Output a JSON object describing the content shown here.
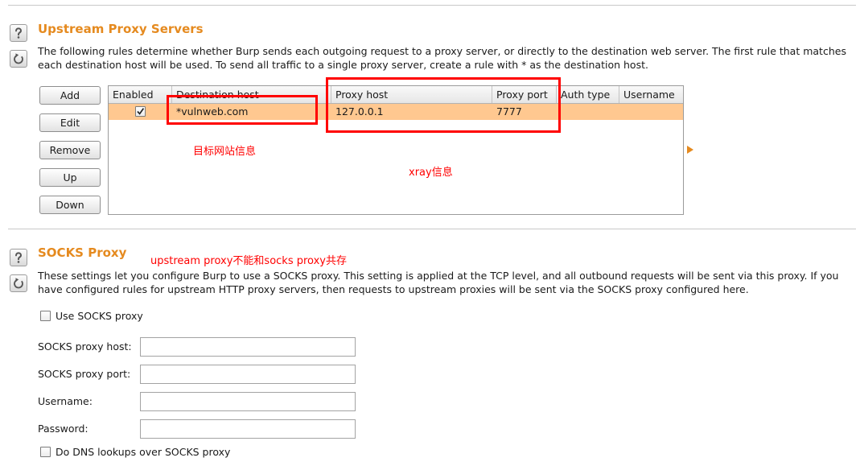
{
  "colors": {
    "heading": "#e58a1f",
    "selected_row": "#ffc890",
    "annotation": "#ff0000"
  },
  "upstream_proxy": {
    "title": "Upstream Proxy Servers",
    "icons": {
      "help": "help-icon",
      "reset": "reset-icon",
      "expand": "right-triangle-icon"
    },
    "description": [
      "The following rules determine whether Burp sends each outgoing request to a proxy server, or directly to the destination web server. The first rule that matches",
      "each destination host will be used. To send all traffic to a single proxy server, create a rule with * as the destination host."
    ],
    "buttons": {
      "add": "Add",
      "edit": "Edit",
      "remove": "Remove",
      "up": "Up",
      "down": "Down"
    },
    "table": {
      "columns": [
        "Enabled",
        "Destination host",
        "Proxy host",
        "Proxy port",
        "Auth type",
        "Username"
      ],
      "rows": [
        {
          "enabled": true,
          "destination_host": "*vulnweb.com",
          "proxy_host": "127.0.0.1",
          "proxy_port": "7777"
        }
      ],
      "selected_row": 0
    }
  },
  "annotations": {
    "target_site": "目标网站信息",
    "xray": "xray信息",
    "coexist_note": "upstream proxy不能和socks proxy共存"
  },
  "socks_proxy": {
    "title": "SOCKS Proxy",
    "icons": {
      "help": "help-icon",
      "reset": "reset-icon"
    },
    "description": [
      "These settings let you configure Burp to use a SOCKS proxy. This setting is applied at the TCP level, and all outbound requests will be sent via this proxy. If you",
      "have configured rules for upstream HTTP proxy servers, then requests to upstream proxies will be sent via the SOCKS proxy configured here."
    ],
    "use_socks_proxy": {
      "label": "Use SOCKS proxy",
      "checked": false
    },
    "fields": [
      {
        "label": "SOCKS proxy host:"
      },
      {
        "label": "SOCKS proxy port:"
      },
      {
        "label": "Username:"
      },
      {
        "label": "Password:"
      }
    ],
    "dns_over_socks": {
      "label": "Do DNS lookups over SOCKS proxy",
      "checked": false
    }
  }
}
